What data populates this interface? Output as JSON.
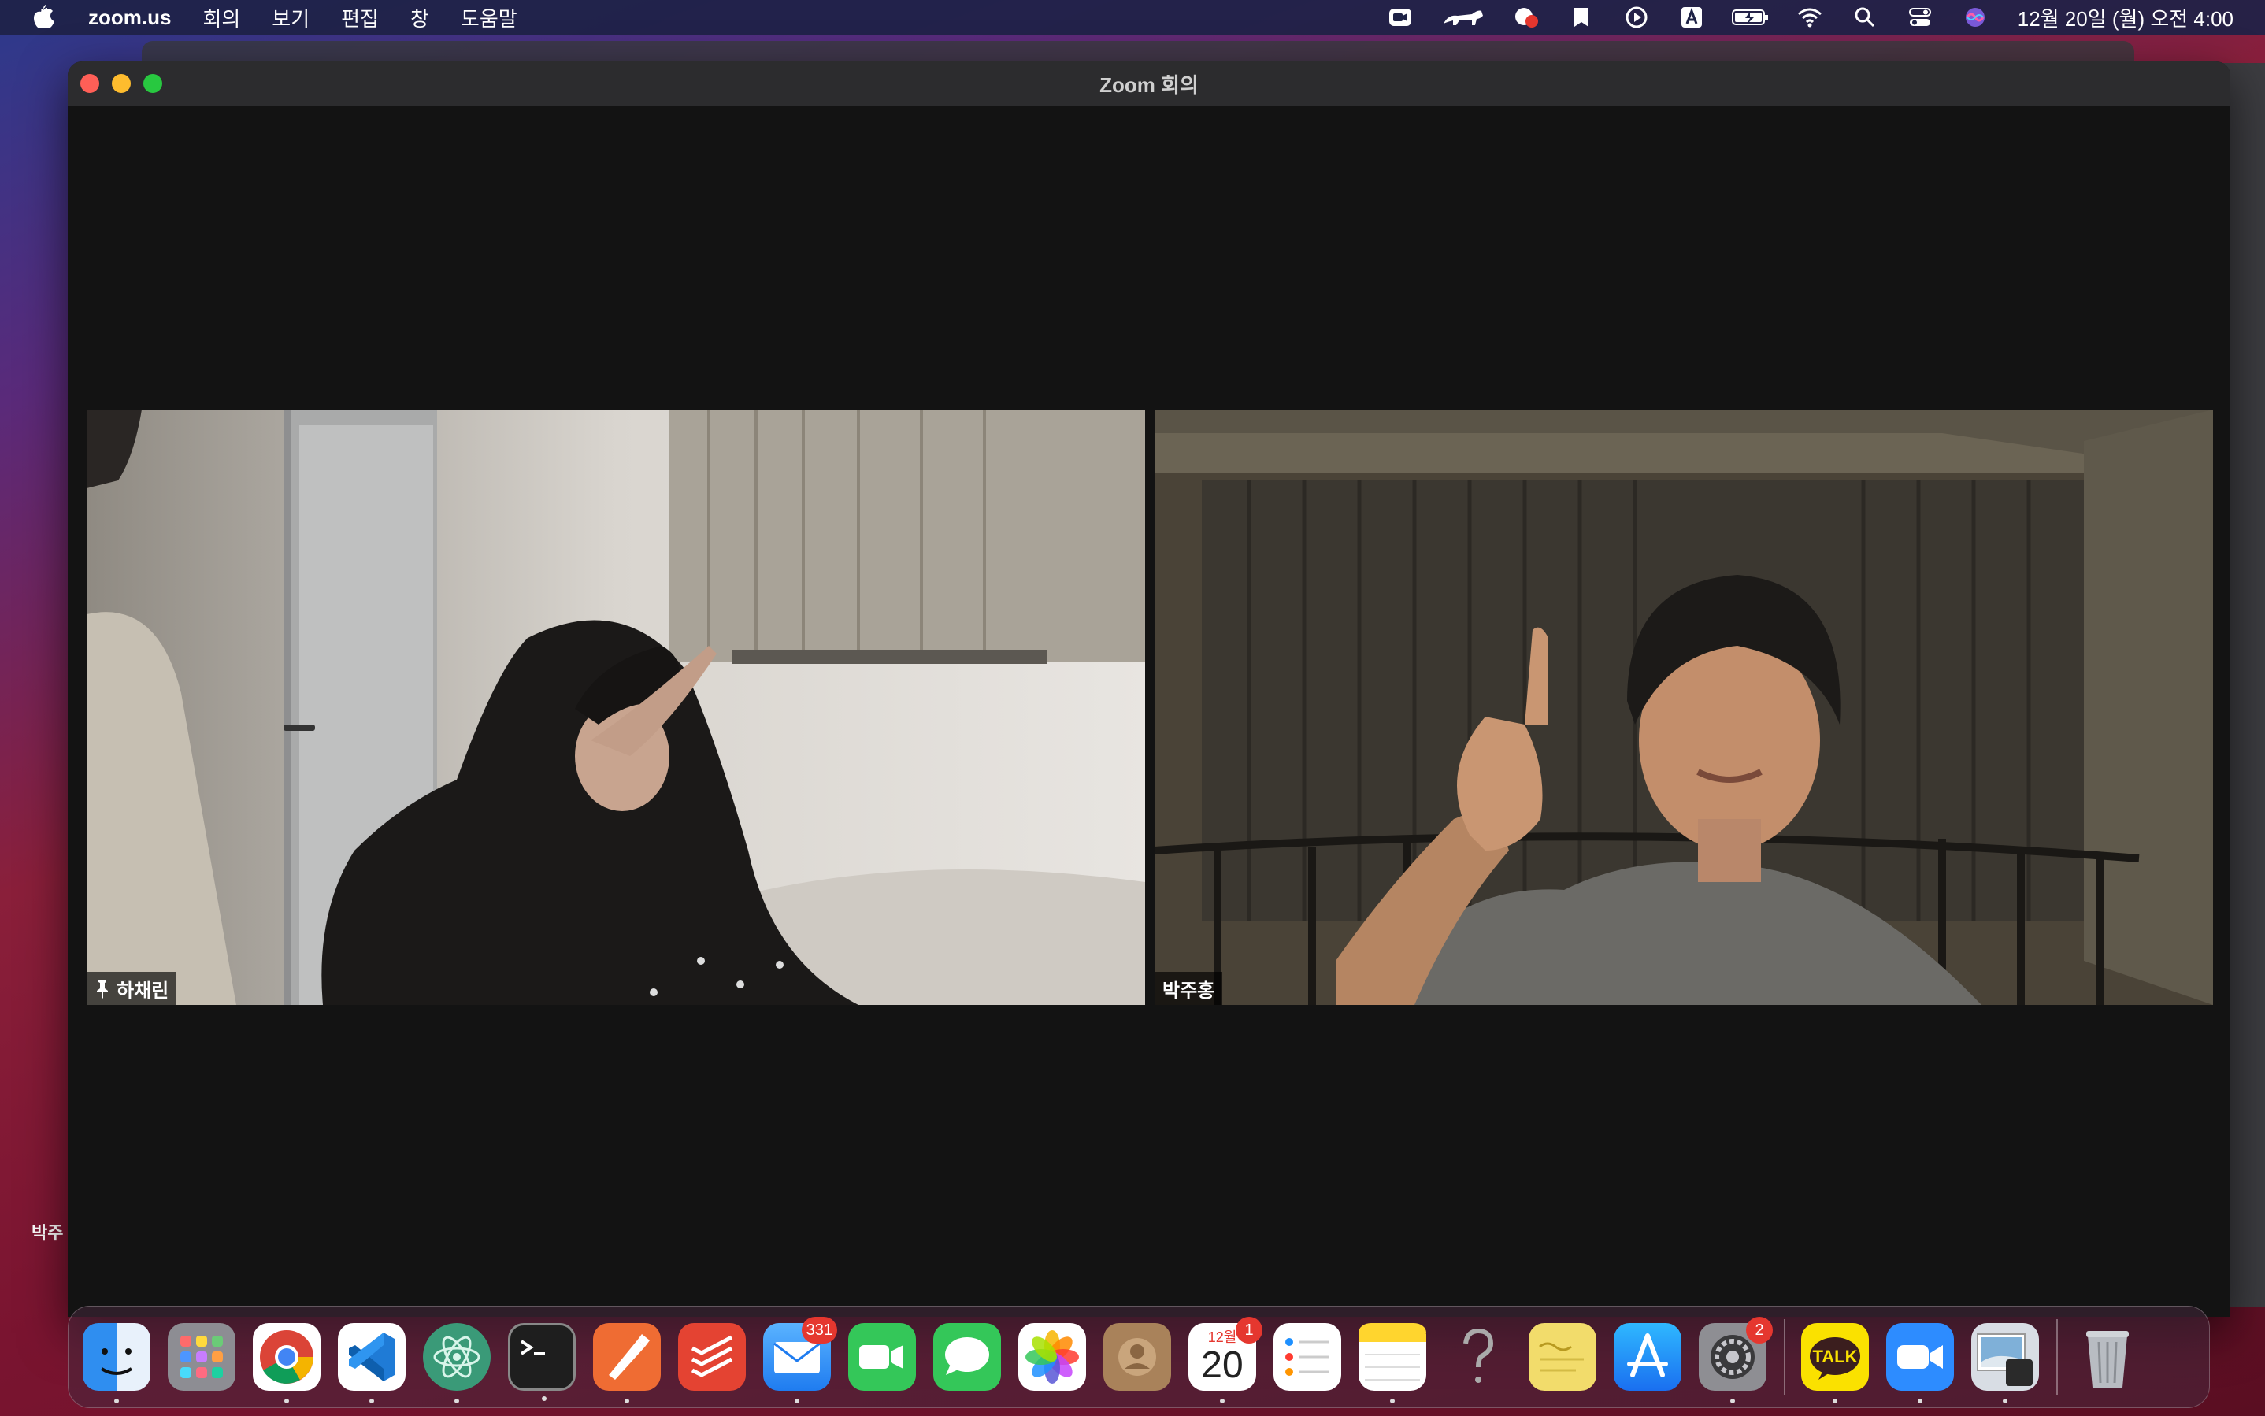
{
  "menubar": {
    "app_name": "zoom.us",
    "menus": [
      "회의",
      "보기",
      "편집",
      "창",
      "도움말"
    ],
    "clock": "12월 20일 (월) 오전  4:00"
  },
  "window": {
    "title": "Zoom 회의"
  },
  "participants": [
    {
      "name": "하채린",
      "pinned": true
    },
    {
      "name": "박주홍",
      "pinned": false
    }
  ],
  "desktop_label": "박주",
  "dock": {
    "mail_badge": "331",
    "calendar_badge": "1",
    "calendar_month": "12월",
    "calendar_day": "20",
    "settings_badge": "2",
    "kakao_label": "TALK"
  }
}
